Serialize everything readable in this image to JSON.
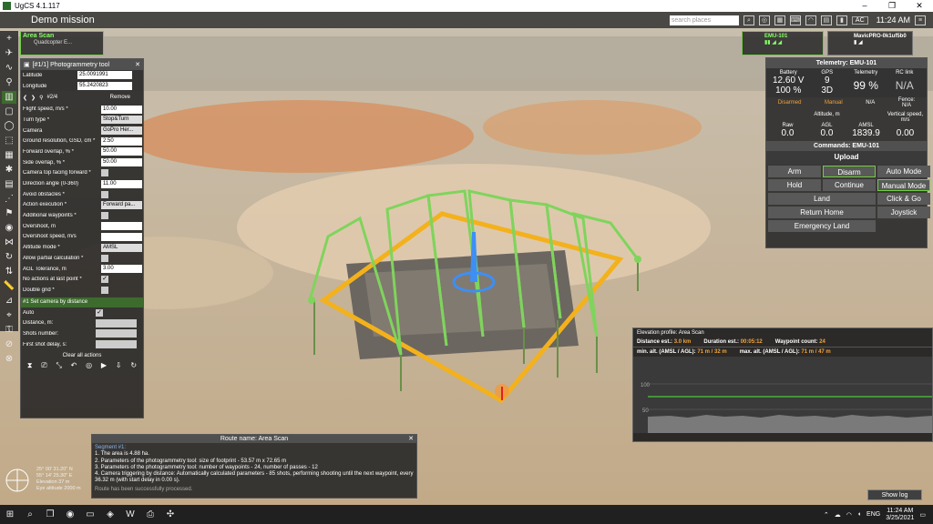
{
  "window": {
    "title": "UgCS 4.1.117"
  },
  "topbar": {
    "mission": "Demo mission",
    "search_placeholder": "search places",
    "time": "11:24 AM",
    "ac": "AC"
  },
  "vehicle_card": {
    "route": "Area Scan",
    "vehicle": "Quadcopter E..."
  },
  "tool_panel": {
    "title": "[#1/1] Photogrammetry tool",
    "latitude_label": "Latitude",
    "latitude": "25.0091991",
    "longitude_label": "Longitude",
    "longitude": "55.2420823",
    "nav_label": "#2/4",
    "remove": "Remove",
    "params": [
      {
        "label": "Flight speed, m/s *",
        "value": "10.00",
        "kind": "input"
      },
      {
        "label": "Turn type *",
        "value": "Stop&Turn",
        "kind": "select"
      },
      {
        "label": "Camera",
        "value": "GoPro Her...",
        "kind": "select"
      },
      {
        "label": "Ground resolution, GSD, cm *",
        "value": "2.50",
        "kind": "input"
      },
      {
        "label": "Forward overlap, % *",
        "value": "50.00",
        "kind": "input"
      },
      {
        "label": "Side overlap, % *",
        "value": "50.00",
        "kind": "input"
      },
      {
        "label": "Camera top facing forward *",
        "value": "",
        "kind": "check"
      },
      {
        "label": "Direction angle (0-360)",
        "value": "11.00",
        "kind": "input"
      },
      {
        "label": "Avoid obstacles *",
        "value": "",
        "kind": "check"
      },
      {
        "label": "Action execution *",
        "value": "Forward pa...",
        "kind": "select"
      },
      {
        "label": "Additional waypoints *",
        "value": "",
        "kind": "check"
      },
      {
        "label": "Overshoot, m",
        "value": "",
        "kind": "input"
      },
      {
        "label": "Overshoot speed, m/s",
        "value": "",
        "kind": "input"
      },
      {
        "label": "Altitude mode *",
        "value": "AMSL",
        "kind": "select"
      },
      {
        "label": "Allow partial calculation *",
        "value": "",
        "kind": "check"
      },
      {
        "label": "AGL Tolerance, m",
        "value": "3.00",
        "kind": "input"
      },
      {
        "label": "No actions at last point *",
        "value": "",
        "kind": "checkon"
      },
      {
        "label": "Double grid *",
        "value": "",
        "kind": "check"
      }
    ],
    "section": "#1 Set camera by distance",
    "sub_params": [
      {
        "label": "Auto",
        "kind": "checkon"
      },
      {
        "label": "Distance, m:",
        "kind": "input"
      },
      {
        "label": "Shots number:",
        "kind": "input"
      },
      {
        "label": "First shot delay, s:",
        "kind": "input"
      }
    ],
    "clear_all": "Clear all actions"
  },
  "drones": [
    {
      "name": "EMU-101"
    },
    {
      "name": "MavicPRO-0k1uf5b0"
    }
  ],
  "telemetry": {
    "title": "Telemetry: EMU-101",
    "battery_label": "Battery",
    "battery_v": "12.60 V",
    "battery_pct": "100 %",
    "gps_label": "GPS",
    "gps_sats": "9",
    "gps_fix": "3D",
    "telemetry_label": "Telemetry",
    "telemetry_val": "99 %",
    "rc_label": "RC link",
    "rc_val": "N/A",
    "disarmed": "Disarmed",
    "manual": "Manual",
    "na": "N/A",
    "fence_label": "Fence:",
    "fence_val": "N/A",
    "altitude_label": "Altitude, m",
    "vspeed_label": "Vertical speed, m/s",
    "raw_label": "Raw",
    "raw": "0.0",
    "agl_label": "AGL",
    "agl": "0.0",
    "amsl_label": "AMSL",
    "amsl": "1839.9",
    "vspeed": "0.00"
  },
  "commands": {
    "title": "Commands: EMU-101",
    "upload": "Upload",
    "buttons": [
      [
        "Arm",
        "Disarm",
        "Auto Mode"
      ],
      [
        "Hold",
        "Continue",
        "Manual Mode"
      ],
      [
        "Land",
        "",
        "Click & Go"
      ],
      [
        "Return Home",
        "",
        "Joystick"
      ],
      [
        "Emergency Land",
        "",
        ""
      ]
    ]
  },
  "elevation": {
    "title": "Elevation profile: Area Scan",
    "distance_label": "Distance est.:",
    "distance": "3.0 km",
    "duration_label": "Duration est.:",
    "duration": "00:05:12",
    "waypoints_label": "Waypoint count:",
    "waypoints": "24",
    "min_label": "min. alt. (AMSL / AGL):",
    "min": "71 m / 32 m",
    "max_label": "max. alt. (AMSL / AGL):",
    "max": "71 m / 47 m",
    "tick_100": "100",
    "tick_50": "50"
  },
  "route": {
    "title": "Route name: Area Scan",
    "segment": "Segment #1:",
    "l1": "1. The area is 4.88 ha.",
    "l2": "2. Parameters of the photogrammetry tool: size of footprint - 53.57 m x 72.65 m",
    "l3": "3. Parameters of the photogrammetry tool: number of waypoints - 24, number of passes - 12",
    "l4": "4. Camera triggering by distance: Automatically calculated parameters - 85 shots, performing shooting until the next waypoint, every 36.32 m (with start delay in 0.00 s).",
    "ok": "Route has been successfully processed."
  },
  "footer": {
    "show_log": "Show log",
    "coord1": "25° 00' 31.20\" N",
    "coord2": "55° 14' 25.30\" E",
    "elev": "Elevation 37 m",
    "eye": "Eye altitude 2000 m"
  },
  "taskbar": {
    "lang": "ENG",
    "time": "11:24 AM",
    "date": "3/25/2021"
  }
}
